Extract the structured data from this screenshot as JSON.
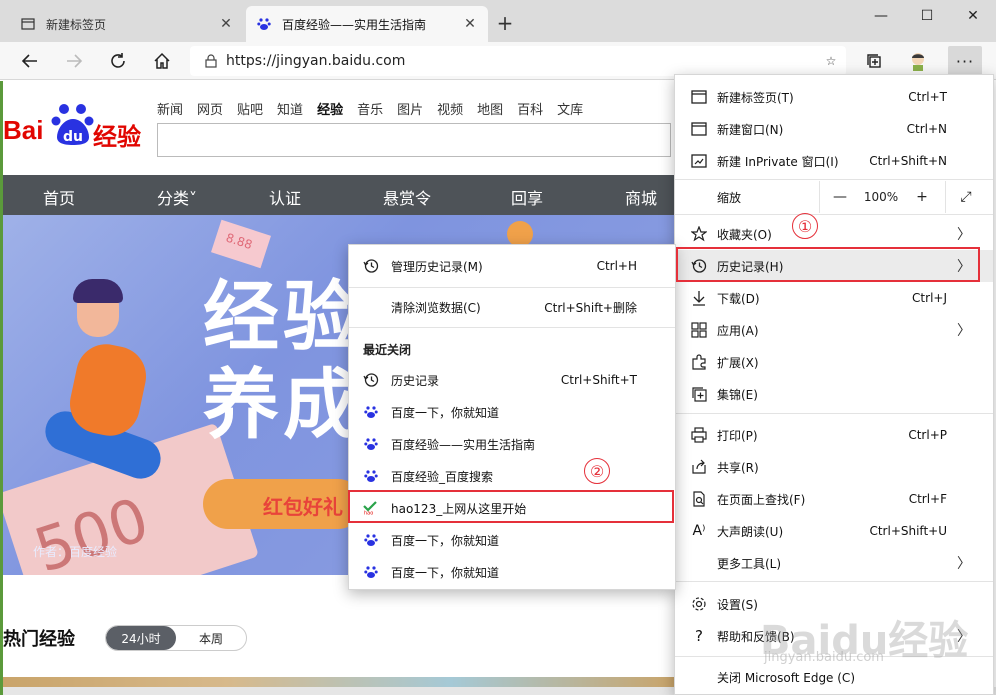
{
  "tabs": [
    {
      "title": "新建标签页",
      "icon": "new-tab-page-icon"
    },
    {
      "title": "百度经验——实用生活指南",
      "icon": "baidu-paw-icon"
    }
  ],
  "window": {
    "minimize": "—",
    "maximize": "☐",
    "close": "✕",
    "newtab": "+"
  },
  "address": {
    "url": "https://jingyan.baidu.com"
  },
  "site": {
    "logo_text": "Bai",
    "logo_du": "du",
    "logo_suffix": "经验",
    "topnav": [
      "新闻",
      "网页",
      "贴吧",
      "知道",
      "经验",
      "音乐",
      "图片",
      "视频",
      "地图",
      "百科",
      "文库"
    ],
    "mainnav": [
      "首页",
      "分类˅",
      "认证",
      "悬赏令",
      "回享",
      "商城"
    ],
    "banner": {
      "line1": "经验",
      "line2": "养成",
      "button": "红包好礼",
      "author": "作者：百度经验",
      "money": "500",
      "ticket": "8.88"
    },
    "hot_title": "热门经验",
    "hot_toggle": [
      "24小时",
      "本周"
    ]
  },
  "main_menu": {
    "new_tab": {
      "label": "新建标签页(T)",
      "shortcut": "Ctrl+T"
    },
    "new_window": {
      "label": "新建窗口(N)",
      "shortcut": "Ctrl+N"
    },
    "inprivate": {
      "label": "新建 InPrivate 窗口(I)",
      "shortcut": "Ctrl+Shift+N"
    },
    "zoom": {
      "label": "缩放",
      "minus": "—",
      "value": "100%",
      "plus": "+",
      "fullscreen": "⤢"
    },
    "favorites": {
      "label": "收藏夹(O)"
    },
    "history": {
      "label": "历史记录(H)"
    },
    "downloads": {
      "label": "下载(D)",
      "shortcut": "Ctrl+J"
    },
    "apps": {
      "label": "应用(A)"
    },
    "extensions": {
      "label": "扩展(X)"
    },
    "collections": {
      "label": "集锦(E)"
    },
    "print": {
      "label": "打印(P)",
      "shortcut": "Ctrl+P"
    },
    "share": {
      "label": "共享(R)"
    },
    "find": {
      "label": "在页面上查找(F)",
      "shortcut": "Ctrl+F"
    },
    "read_aloud": {
      "label": "大声朗读(U)",
      "shortcut": "Ctrl+Shift+U"
    },
    "more_tools": {
      "label": "更多工具(L)"
    },
    "settings": {
      "label": "设置(S)"
    },
    "help": {
      "label": "帮助和反馈(B)"
    },
    "close_edge": {
      "label": "关闭 Microsoft Edge (C)"
    }
  },
  "history_menu": {
    "manage": {
      "label": "管理历史记录(M)",
      "shortcut": "Ctrl+H"
    },
    "clear": {
      "label": "清除浏览数据(C)",
      "shortcut": "Ctrl+Shift+删除"
    },
    "recent_header": "最近关闭",
    "items": [
      {
        "label": "历史记录",
        "shortcut": "Ctrl+Shift+T",
        "icon": "history-clock-icon"
      },
      {
        "label": "百度一下，你就知道",
        "shortcut": "",
        "icon": "baidu-paw-icon"
      },
      {
        "label": "百度经验——实用生活指南",
        "shortcut": "",
        "icon": "baidu-paw-icon"
      },
      {
        "label": "百度经验_百度搜索",
        "shortcut": "",
        "icon": "baidu-paw-icon"
      },
      {
        "label": "hao123_上网从这里开始",
        "shortcut": "",
        "icon": "hao123-icon"
      },
      {
        "label": "百度一下，你就知道",
        "shortcut": "",
        "icon": "baidu-paw-icon"
      },
      {
        "label": "百度一下，你就知道",
        "shortcut": "",
        "icon": "baidu-paw-icon"
      }
    ]
  },
  "annotations": {
    "step1": "①",
    "step2": "②"
  },
  "watermark": {
    "brand": "Baidu经验",
    "url": "jingyan.baidu.com"
  },
  "colors": {
    "accent_red": "#e5303a",
    "baidu_blue": "#2932e1",
    "baidu_red": "#e10601",
    "nav_bg": "#4e5358"
  }
}
